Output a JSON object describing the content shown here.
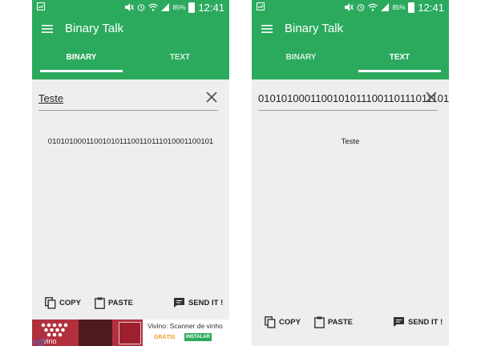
{
  "screens": [
    {
      "status": {
        "battery": "85%",
        "time": "12:41"
      },
      "app_title": "Binary Talk",
      "tabs": [
        {
          "label": "BINARY"
        },
        {
          "label": "TEXT"
        }
      ],
      "active_tab": "BINARY",
      "input_value": "Teste",
      "output_value": "0101010001100101011100110111010001100101",
      "actions": {
        "copy": "COPY",
        "paste": "PASTE",
        "send": "SEND IT !"
      },
      "ad": {
        "title": "Vivino: Scanner de vinho",
        "price": "GRÁTIS",
        "button": "INSTALAR",
        "brand": "vino"
      }
    },
    {
      "status": {
        "battery": "85%",
        "time": "12:41"
      },
      "app_title": "Binary Talk",
      "tabs": [
        {
          "label": "BINARY"
        },
        {
          "label": "TEXT"
        }
      ],
      "active_tab": "TEXT",
      "input_value": "0101010001100101011100110111011101",
      "output_value": "Teste",
      "actions": {
        "copy": "COPY",
        "paste": "PASTE",
        "send": "SEND IT !"
      }
    }
  ],
  "colors": {
    "app_bar": "#2baa5e",
    "content_bg": "#eeeeee",
    "text": "#212121"
  },
  "icons": [
    "menu-icon",
    "clear-icon",
    "copy-icon",
    "paste-icon",
    "send-chat-icon",
    "wifi-icon",
    "signal-icon",
    "battery-icon",
    "alarm-icon",
    "mute-icon"
  ]
}
